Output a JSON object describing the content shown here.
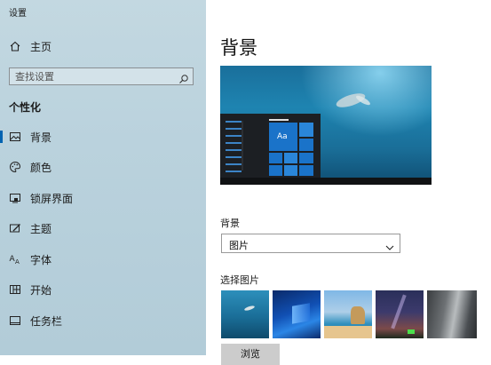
{
  "window": {
    "title": "设置"
  },
  "sidebar": {
    "home_label": "主页",
    "search_placeholder": "查找设置",
    "section_title": "个性化",
    "items": [
      {
        "label": "背景",
        "icon": "image-icon",
        "selected": true
      },
      {
        "label": "颜色",
        "icon": "palette-icon",
        "selected": false
      },
      {
        "label": "锁屏界面",
        "icon": "lock-screen-icon",
        "selected": false
      },
      {
        "label": "主题",
        "icon": "theme-icon",
        "selected": false
      },
      {
        "label": "字体",
        "icon": "font-icon",
        "selected": false
      },
      {
        "label": "开始",
        "icon": "start-icon",
        "selected": false
      },
      {
        "label": "任务栏",
        "icon": "taskbar-icon",
        "selected": false
      }
    ]
  },
  "main": {
    "title": "背景",
    "preview_tile_text": "Aa",
    "background_label": "背景",
    "background_value": "图片",
    "choose_label": "选择图片",
    "browse_label": "浏览"
  },
  "colors": {
    "accent": "#0063b1",
    "tile": "#1a73c9"
  }
}
